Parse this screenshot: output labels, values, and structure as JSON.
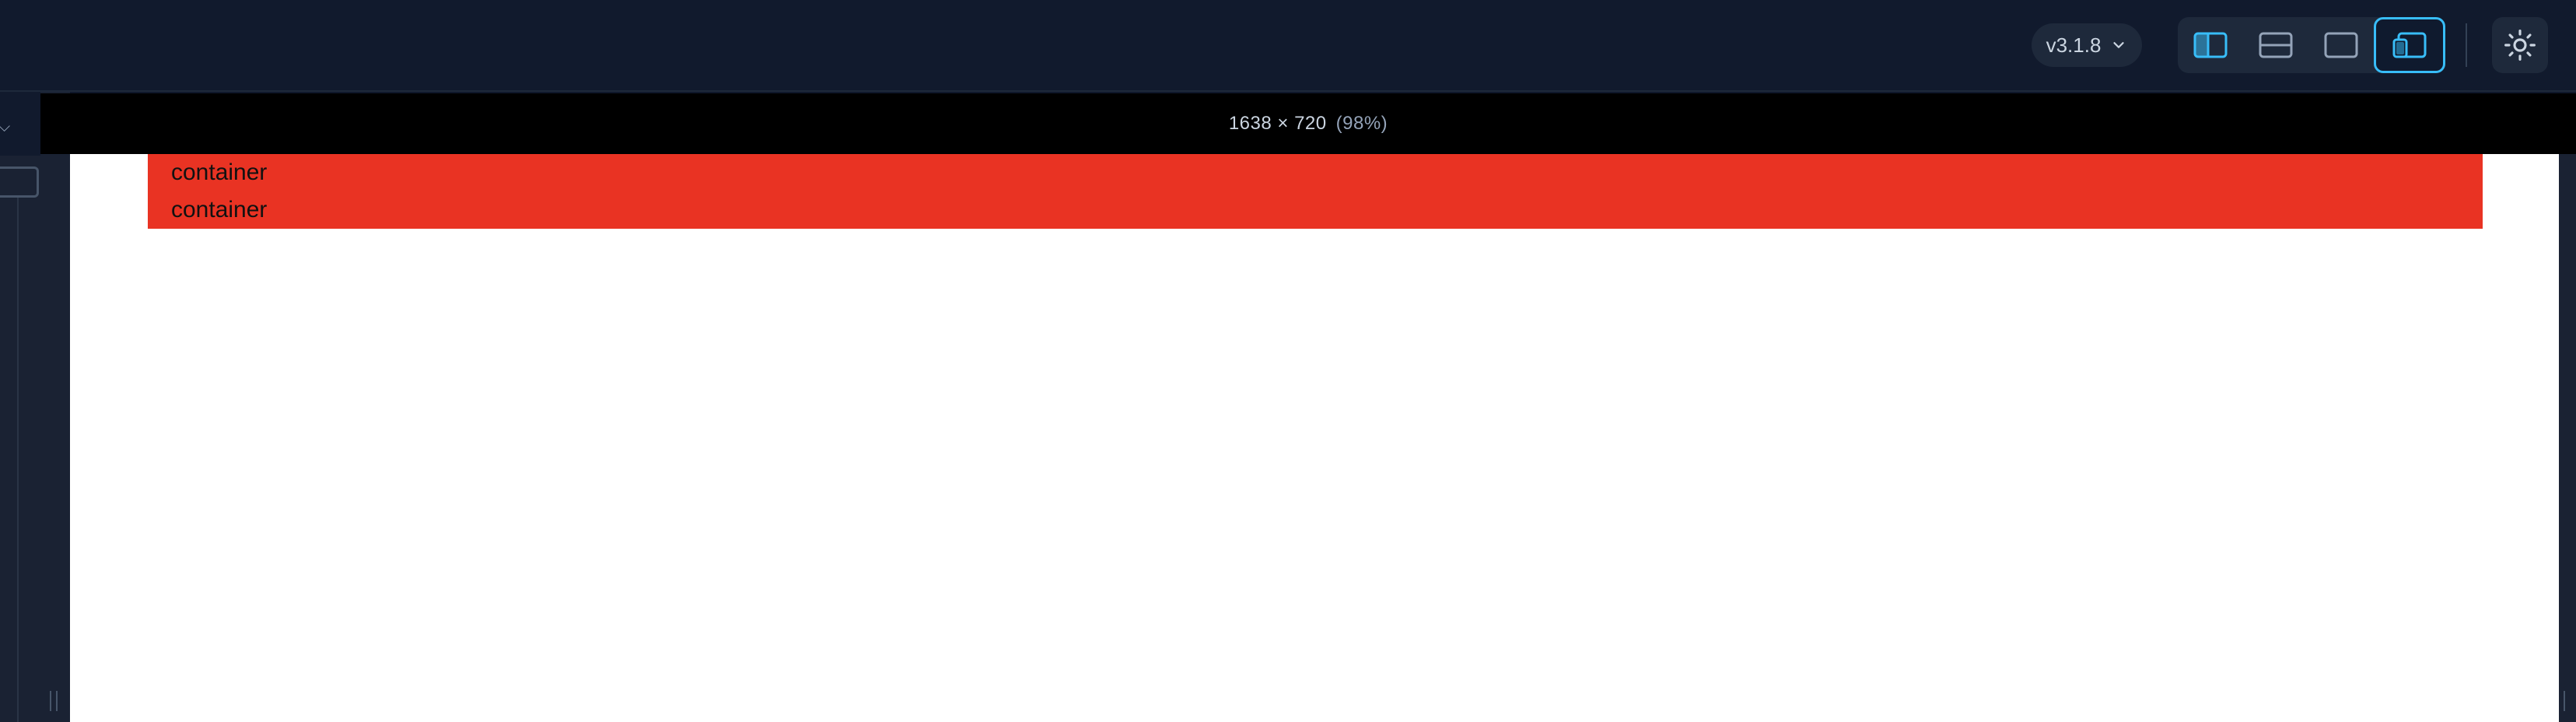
{
  "header": {
    "version_label": "v3.1.8",
    "version_icon": "chevron-down-icon",
    "layout_buttons": [
      {
        "name": "layout-split-vertical",
        "icon": "layout-split-vertical-icon",
        "active": false
      },
      {
        "name": "layout-split-horizontal",
        "icon": "layout-split-horizontal-icon",
        "active": false
      },
      {
        "name": "layout-preview-only",
        "icon": "layout-preview-only-icon",
        "active": false
      },
      {
        "name": "layout-responsive",
        "icon": "layout-responsive-icon",
        "active": true
      }
    ],
    "theme_icon": "sun-icon"
  },
  "preview": {
    "dimensions": "1638 × 720",
    "zoom": "(98%)",
    "boxes": [
      {
        "label": "container"
      },
      {
        "label": "container"
      }
    ]
  },
  "colors": {
    "accent": "#38bdf8",
    "container_bg": "#e93323",
    "header_bg": "#111a2d",
    "panel_bg": "#1e293b"
  }
}
